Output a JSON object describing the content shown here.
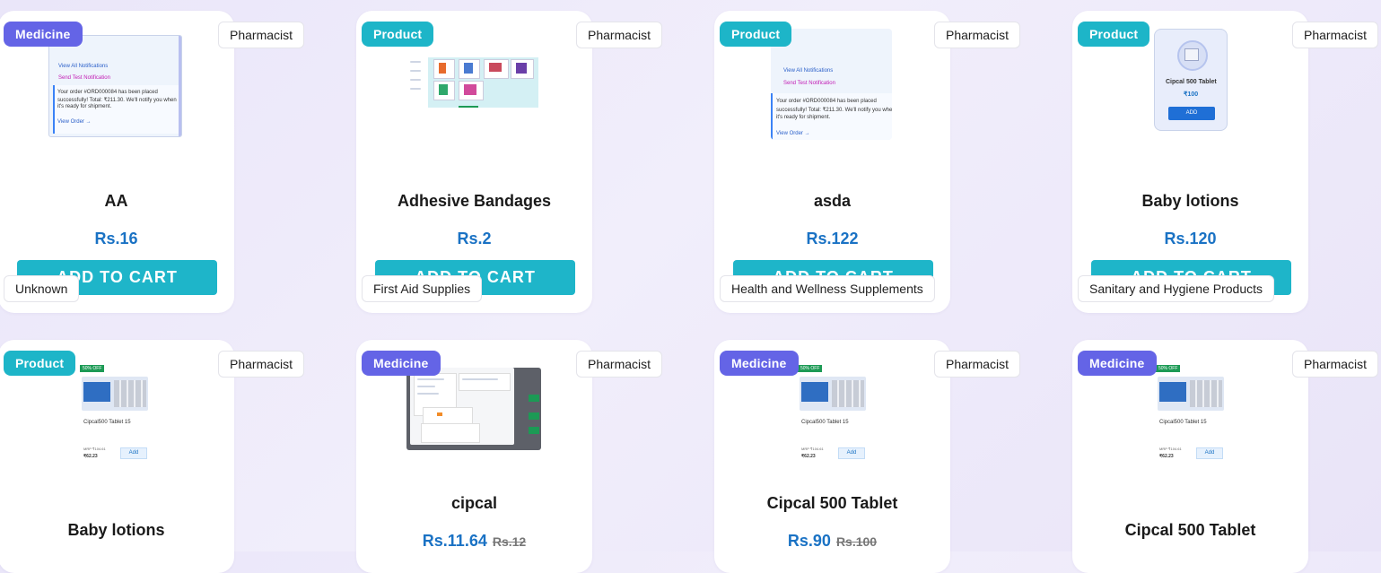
{
  "products": [
    {
      "badge": "Medicine",
      "role": "Pharmacist",
      "name": "AA",
      "price": "Rs.16",
      "old_price": "",
      "button": "ADD TO CART",
      "category": "Unknown"
    },
    {
      "badge": "Product",
      "role": "Pharmacist",
      "name": "Adhesive Bandages",
      "price": "Rs.2",
      "old_price": "",
      "button": "ADD TO CART",
      "category": "First Aid Supplies"
    },
    {
      "badge": "Product",
      "role": "Pharmacist",
      "name": "asda",
      "price": "Rs.122",
      "old_price": "",
      "button": "ADD TO CART",
      "category": "Health and Wellness Supplements"
    },
    {
      "badge": "Product",
      "role": "Pharmacist",
      "name": "Baby lotions",
      "price": "Rs.120",
      "old_price": "",
      "button": "ADD TO CART",
      "category": "Sanitary and Hygiene Products"
    },
    {
      "badge": "Product",
      "role": "Pharmacist",
      "name": "Baby lotions",
      "price": "",
      "old_price": ""
    },
    {
      "badge": "Medicine",
      "role": "Pharmacist",
      "name": "cipcal",
      "price": "Rs.11.64",
      "old_price": "Rs.12"
    },
    {
      "badge": "Medicine",
      "role": "Pharmacist",
      "name": "Cipcal 500 Tablet",
      "price": "Rs.90",
      "old_price": "Rs.100"
    },
    {
      "badge": "Medicine",
      "role": "Pharmacist",
      "name": "Cipcal 500 Tablet",
      "price": "",
      "old_price": ""
    }
  ],
  "thumbs": {
    "notif_view_all": "View All Notifications",
    "notif_send": "Send Test Notification",
    "notif_msg_1": "Your order #ORD000084 has been placed",
    "notif_msg_2": "successfully! Total: ₹211.30. We'll notify you when",
    "notif_msg_3": "it's ready for shipment.",
    "notif_view_order": "View Order →",
    "cipcal_title": "Cipcal 500 Tablet",
    "cipcal_price": "₹100",
    "cipcal_add": "ADD",
    "off_tag": "50% OFF",
    "strip_name": "Cipcal500 Tablet 15",
    "strip_mrp": "MRP ₹104.61",
    "strip_price": "₹62.23",
    "strip_add": "Add"
  },
  "colors": {
    "medicine_badge": "#6464e6",
    "product_badge": "#1db5c8",
    "cart_button": "#1eb5c9",
    "price": "#1a72c4"
  }
}
